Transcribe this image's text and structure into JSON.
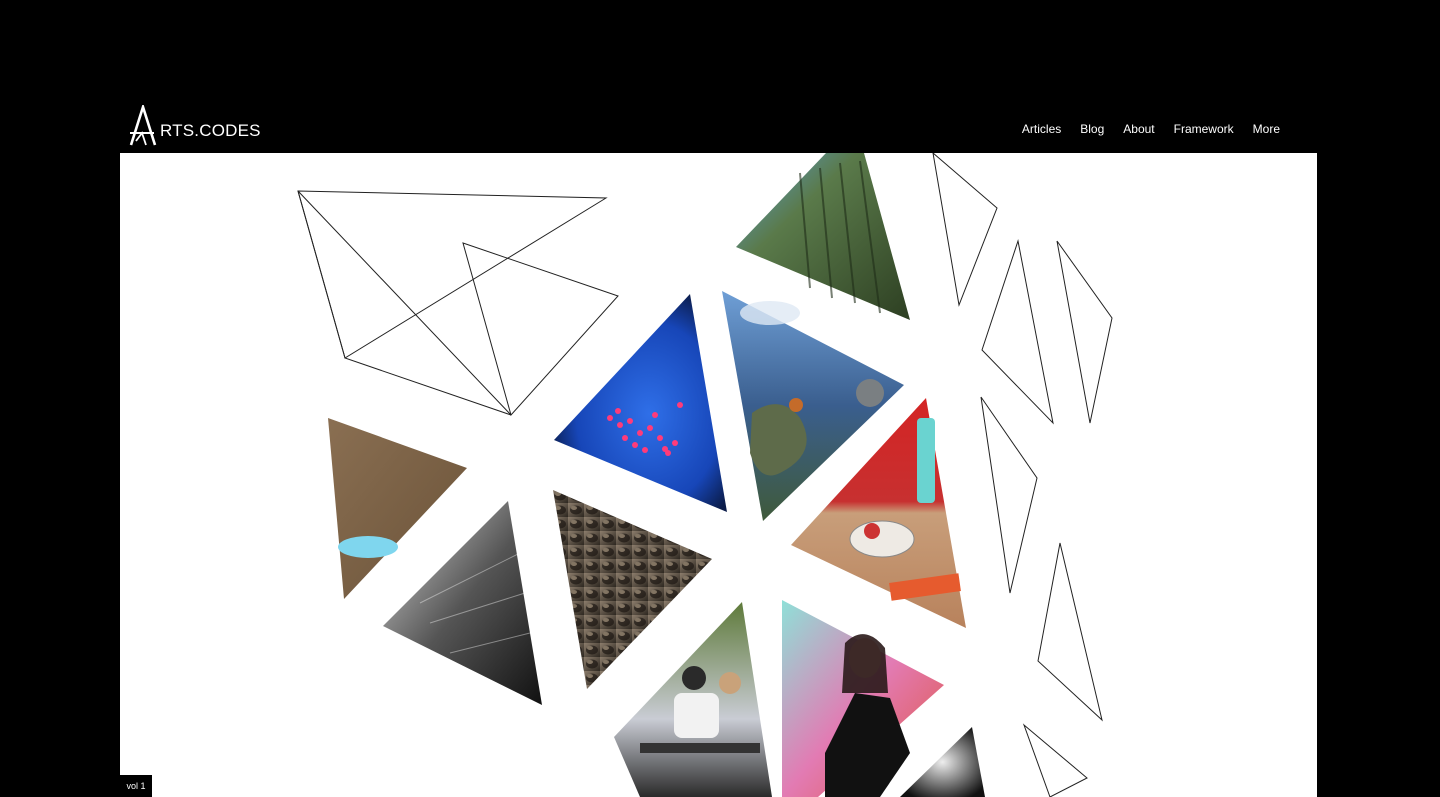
{
  "header": {
    "logo_initial": "A",
    "logo_text": "RTS.CODES",
    "nav": [
      {
        "label": "Articles"
      },
      {
        "label": "Blog"
      },
      {
        "label": "About"
      },
      {
        "label": "Framework"
      },
      {
        "label": "More"
      }
    ]
  },
  "hero": {
    "photo_tiles": [
      {
        "subject": "glitched-landscape"
      },
      {
        "subject": "petri-dish-blue-red"
      },
      {
        "subject": "sky-sculpture"
      },
      {
        "subject": "tan-surface-blue-dish"
      },
      {
        "subject": "robot-object-red-wall"
      },
      {
        "subject": "engraving-bw"
      },
      {
        "subject": "textured-relief"
      },
      {
        "subject": "park-bench-couple"
      },
      {
        "subject": "portrait-woman-pink"
      },
      {
        "subject": "bw-fractal"
      }
    ]
  },
  "footer": {
    "volume_label": "vol 1"
  }
}
